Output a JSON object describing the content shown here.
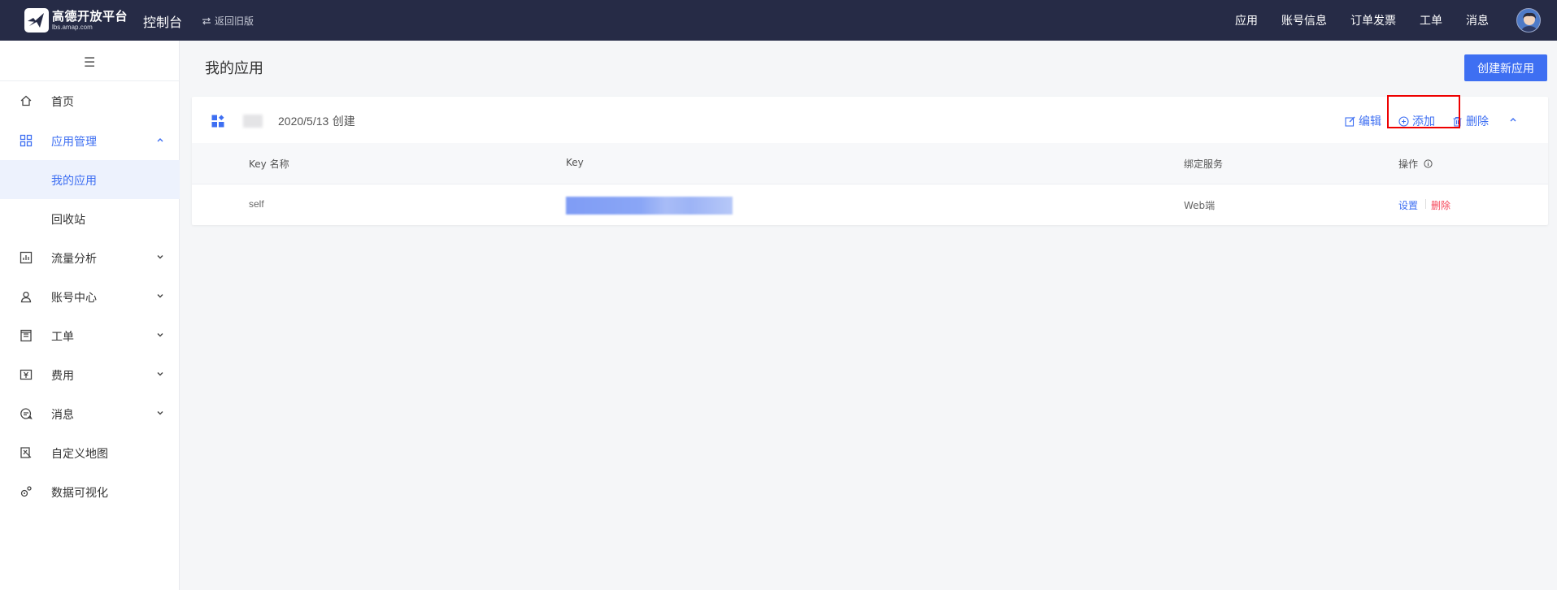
{
  "header": {
    "logo_title": "高德开放平台",
    "logo_subtitle": "lbs.amap.com",
    "console": "控制台",
    "back_old": "返回旧版",
    "nav": [
      "应用",
      "账号信息",
      "订单发票",
      "工单",
      "消息"
    ]
  },
  "sidebar": {
    "menu_icon": "☰",
    "items": [
      {
        "label": "首页",
        "icon": "home-icon"
      },
      {
        "label": "应用管理",
        "icon": "grid-icon",
        "expanded": true
      },
      {
        "label": "我的应用",
        "sub": true,
        "selected": true
      },
      {
        "label": "回收站",
        "sub": true
      },
      {
        "label": "流量分析",
        "icon": "chart-icon"
      },
      {
        "label": "账号中心",
        "icon": "user-icon"
      },
      {
        "label": "工单",
        "icon": "ticket-icon"
      },
      {
        "label": "费用",
        "icon": "money-icon"
      },
      {
        "label": "消息",
        "icon": "message-icon"
      },
      {
        "label": "自定义地图",
        "icon": "map-icon"
      },
      {
        "label": "数据可视化",
        "icon": "visual-icon"
      }
    ]
  },
  "main": {
    "title": "我的应用",
    "create_button": "创建新应用",
    "app": {
      "created_date": "2020/5/13",
      "created_suffix": "创建",
      "actions": {
        "edit": "编辑",
        "add": "添加",
        "delete": "删除"
      },
      "table": {
        "headers": {
          "key_name": "Key 名称",
          "key": "Key",
          "service": "绑定服务",
          "ops": "操作"
        },
        "rows": [
          {
            "key_name": "self",
            "service": "Web端",
            "op_settings": "设置",
            "op_delete": "删除"
          }
        ]
      }
    }
  },
  "colors": {
    "accent": "#3e6ff2",
    "topbar": "#262b46",
    "danger": "#f5475a",
    "highlight": "#ee0000"
  }
}
